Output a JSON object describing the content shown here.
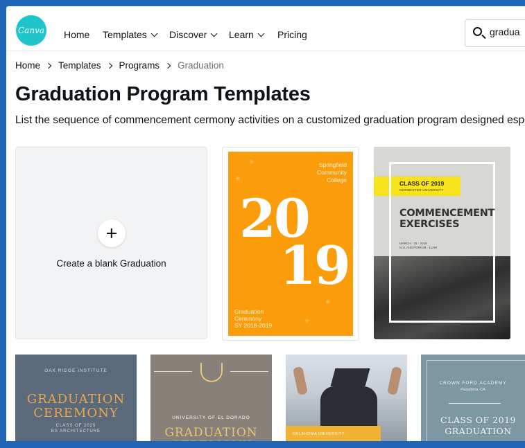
{
  "nav": {
    "logo": "Canva",
    "items": [
      "Home",
      "Templates",
      "Discover",
      "Learn",
      "Pricing"
    ],
    "search_value": "gradua"
  },
  "breadcrumb": [
    "Home",
    "Templates",
    "Programs",
    "Graduation"
  ],
  "page": {
    "title": "Graduation Program Templates",
    "description": "List the sequence of commencement cermony activities on a customized graduation program designed especia"
  },
  "blank_card": {
    "label": "Create a blank Graduation"
  },
  "templates": [
    {
      "college": "Springfield\nCommunity\nCollege",
      "year_top": "20",
      "year_bottom": "19",
      "caption": "Graduation\nCeremony\nSY 2018-2019",
      "accent": "#fb9d0a"
    },
    {
      "class": "CLASS OF 2019",
      "university": "NORWESTER UNIVERSITY",
      "title": "COMMENCEMENT\nEXERCISES",
      "date": "MARCH - 25 - 2019\nN.U. AUDITORIUM - 11AM",
      "accent": "#f7e31b"
    },
    {
      "institute": "OAK RIDGE INSTITUTE",
      "title": "GRADUATION\nCEREMONY",
      "class": "CLASS OF 2025\nBS ARCHITECTURE"
    },
    {
      "university": "UNIVERSITY OF EL DORADO",
      "title": "GRADUATION\nCEREMONY"
    },
    {
      "university": "OKLAHOMA UNIVERSITY"
    },
    {
      "academy": "CROWN FORD ACADEMY",
      "location": "Pasadena, CA",
      "title": "CLASS OF 2019\nGRADUATION"
    }
  ]
}
